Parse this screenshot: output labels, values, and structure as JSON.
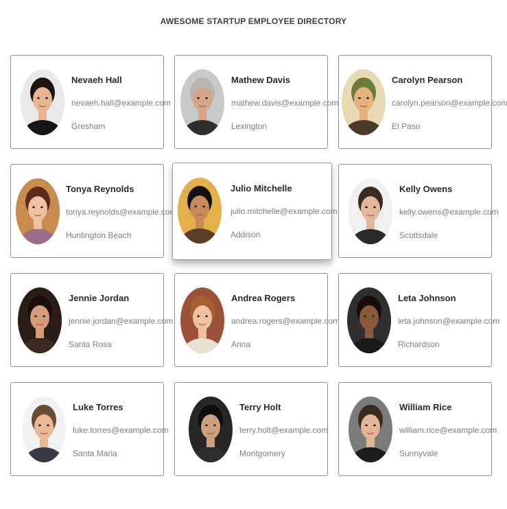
{
  "header": {
    "title": "AWESOME STARTUP EMPLOYEE DIRECTORY"
  },
  "employees": [
    {
      "name": "Nevaeh Hall",
      "email": "nevaeh.hall@example.com",
      "city": "Gresham",
      "bg": "#e9e9e9",
      "skin": "#e7b592",
      "hair": "#1e1410",
      "shirt": "#151515"
    },
    {
      "name": "Mathew Davis",
      "email": "mathew.davis@example.com",
      "city": "Lexington",
      "bg": "#c7c9cb",
      "skin": "#d6a488",
      "hair": "#b9b5b0",
      "shirt": "#2e2e2e"
    },
    {
      "name": "Carolyn Pearson",
      "email": "carolyn.pearson@example.com",
      "city": "El Paso",
      "bg": "#e7d9b4",
      "skin": "#e8b27e",
      "hair": "#6b7d3a",
      "shirt": "#4a3a2a"
    },
    {
      "name": "Tonya Reynolds",
      "email": "tonya.reynolds@example.com",
      "city": "Huntington Beach",
      "bg": "#c98a4d",
      "skin": "#efc1a3",
      "hair": "#5a2a1c",
      "shirt": "#9b6d88"
    },
    {
      "name": "Julio Mitchelle",
      "email": "julio.mitchelle@example.com",
      "city": "Addison",
      "bg": "#e3b04a",
      "skin": "#c98a5a",
      "hair": "#111111",
      "shirt": "#5c3d2a"
    },
    {
      "name": "Kelly Owens",
      "email": "kelly.owens@example.com",
      "city": "Scottsdale",
      "bg": "#f0f0f0",
      "skin": "#e3b69a",
      "hair": "#3a2a20",
      "shirt": "#2b2b2b"
    },
    {
      "name": "Jennie Jordan",
      "email": "jennie.jordan@example.com",
      "city": "Santa Rosa",
      "bg": "#2a1d18",
      "skin": "#d69b78",
      "hair": "#1a0e0a",
      "shirt": "#3b2a22"
    },
    {
      "name": "Andrea Rogers",
      "email": "andrea.rogers@example.com",
      "city": "Anna",
      "bg": "#9c5238",
      "skin": "#eec1a0",
      "hair": "#a5602f",
      "shirt": "#e9e1d2"
    },
    {
      "name": "Leta Johnson",
      "email": "leta.johnson@example.com",
      "city": "Richardson",
      "bg": "#2f2f2f",
      "skin": "#8a5a3c",
      "hair": "#140d0a",
      "shirt": "#1a1a1a"
    },
    {
      "name": "Luke Torres",
      "email": "luke.torres@example.com",
      "city": "Santa Maria",
      "bg": "#f2f2f2",
      "skin": "#e9b996",
      "hair": "#6a4c34",
      "shirt": "#353b47"
    },
    {
      "name": "Terry Holt",
      "email": "terry.holt@example.com",
      "city": "Montgomery",
      "bg": "#262626",
      "skin": "#caa080",
      "hair": "#0e0e0e",
      "shirt": "#2d2d2d"
    },
    {
      "name": "William Rice",
      "email": "william.rice@example.com",
      "city": "Sunnyvale",
      "bg": "#7b7b7b",
      "skin": "#e3b597",
      "hair": "#3a2a1e",
      "shirt": "#1c1c1c"
    }
  ]
}
